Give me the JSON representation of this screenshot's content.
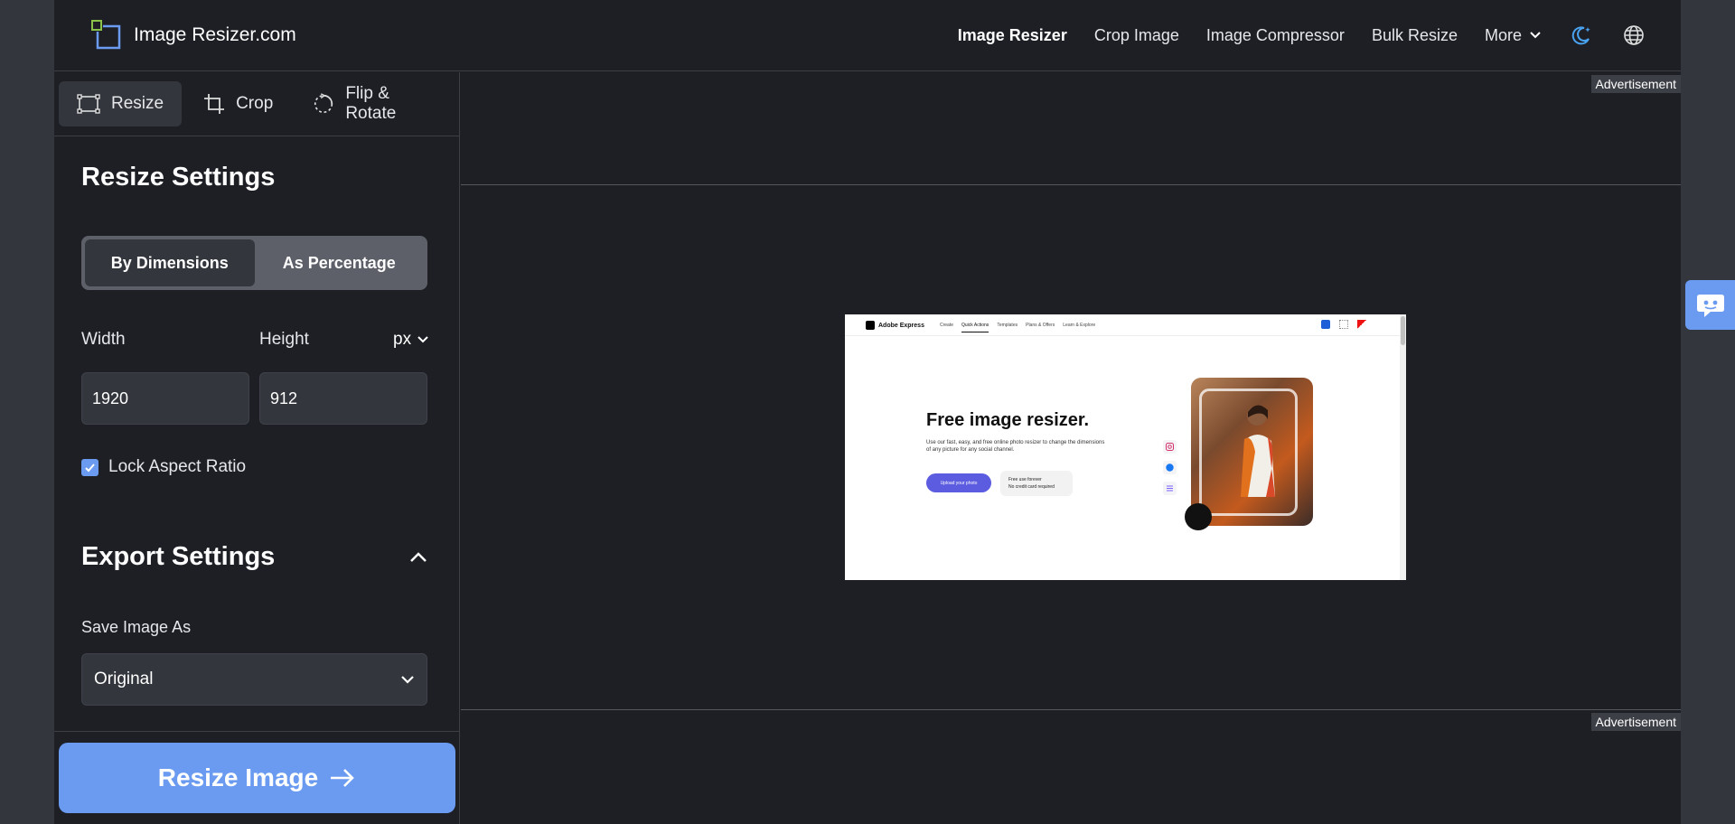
{
  "header": {
    "logo_text": "Image Resizer.com",
    "nav": [
      {
        "label": "Image Resizer"
      },
      {
        "label": "Crop Image"
      },
      {
        "label": "Image Compressor"
      },
      {
        "label": "Bulk Resize"
      },
      {
        "label": "More"
      }
    ],
    "icons": [
      "theme-toggle-icon",
      "globe-icon"
    ]
  },
  "tabs": [
    {
      "label": "Resize",
      "icon": "resize-icon"
    },
    {
      "label": "Crop",
      "icon": "crop-icon"
    },
    {
      "label": "Flip & Rotate",
      "icon": "rotate-icon"
    }
  ],
  "resize": {
    "title": "Resize Settings",
    "mode_options": [
      "By Dimensions",
      "As Percentage"
    ],
    "width_label": "Width",
    "height_label": "Height",
    "unit": "px",
    "width_value": "1920",
    "height_value": "912",
    "lock_label": "Lock Aspect Ratio",
    "lock_checked": true
  },
  "export": {
    "title": "Export Settings",
    "save_as_label": "Save Image As",
    "save_as_value": "Original"
  },
  "resize_button": "Resize Image",
  "ads": {
    "label": "Advertisement"
  },
  "preview": {
    "brand": "Adobe Express",
    "nav_links": [
      "Create",
      "Quick Actions",
      "Templates",
      "Plans & Offers",
      "Learn & Explore"
    ],
    "headline": "Free image resizer.",
    "subtext": "Use our fast, easy, and free online photo resizer to change the dimensions of any picture for any social channel.",
    "cta": "Upload your photo",
    "free_line1": "Free use forever",
    "free_line2": "No credit card required"
  },
  "colors": {
    "accent": "#6a9bf0",
    "bg": "#1d1f25",
    "panel": "#33363c"
  }
}
